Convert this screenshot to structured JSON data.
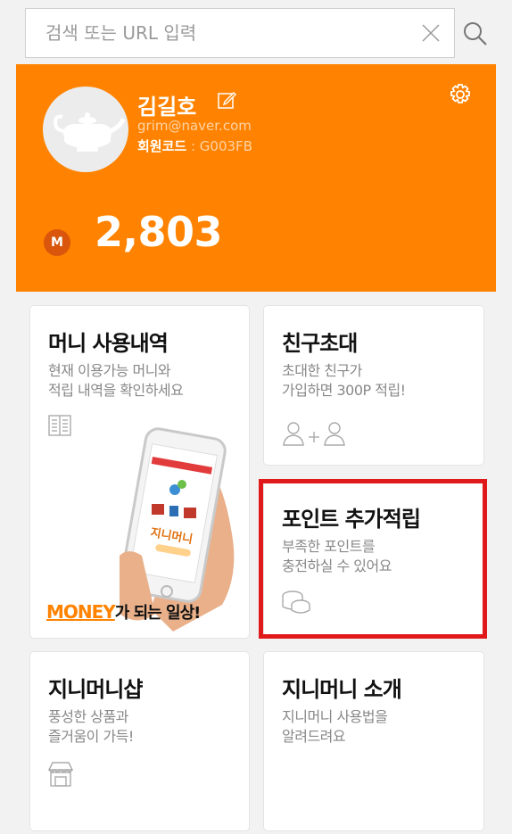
{
  "search": {
    "placeholder": "검색 또는 URL 입력",
    "value": ""
  },
  "profile": {
    "name": "김길호",
    "email": "grim@naver.com",
    "member_code_label": "회원코드",
    "member_code_value": ": G003FB",
    "money_badge": "M",
    "points": "2,803",
    "accent_color": "#ff8300"
  },
  "cards": {
    "money_history": {
      "title": "머니 사용내역",
      "desc_line1": "현재 이용가능 머니와",
      "desc_line2": "적립 내역을 확인하세요",
      "icon": "book-icon",
      "promo": {
        "word": "MONEY",
        "rest": "가 되는 일상!",
        "brand": "지니머니"
      }
    },
    "invite": {
      "title": "친구초대",
      "desc_line1": "초대한 친구가",
      "desc_line2": "가입하면 300P 적립!",
      "icon": "person-plus-person-icon"
    },
    "point_charge": {
      "title": "포인트 추가적립",
      "desc_line1": "부족한 포인트를",
      "desc_line2": "충전하실 수 있어요",
      "icon": "coin-stack-icon"
    },
    "shop": {
      "title": "지니머니샵",
      "desc_line1": "풍성한 상품과",
      "desc_line2": "즐거움이 가득!",
      "icon": "store-icon"
    },
    "about": {
      "title": "지니머니 소개",
      "desc_line1": "지니머니 사용법을",
      "desc_line2": "알려드려요"
    }
  }
}
